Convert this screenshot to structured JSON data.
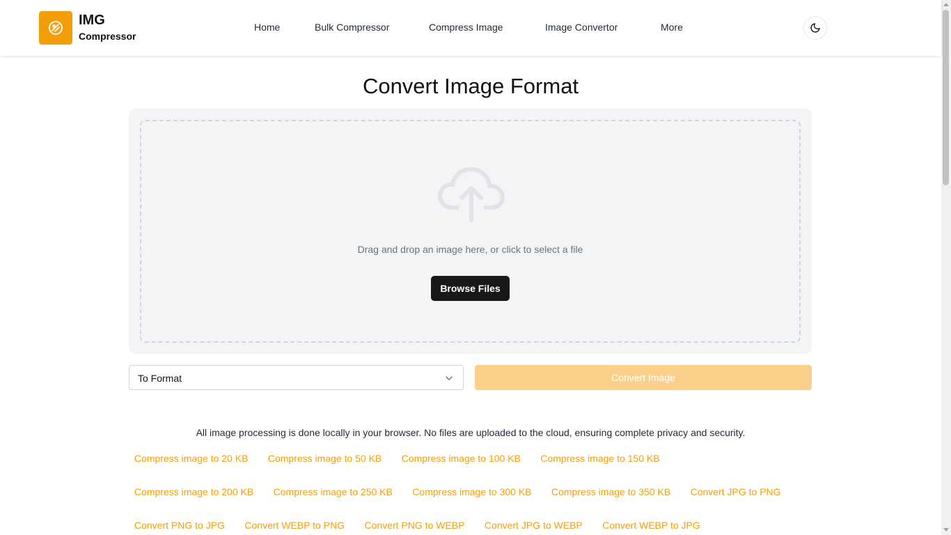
{
  "header": {
    "logo_title": "IMG",
    "logo_subtitle": "Compressor",
    "nav": [
      {
        "label": "Home"
      },
      {
        "label": "Bulk Compressor"
      },
      {
        "label": "Compress Image"
      },
      {
        "label": "Image Convertor"
      },
      {
        "label": "More"
      }
    ],
    "theme_toggle_icon": "moon-icon",
    "brand_color": "#f59e0b"
  },
  "main": {
    "title": "Convert Image Format",
    "dropzone": {
      "icon": "cloud-upload-icon",
      "hint": "Drag and drop an image here, or click to select a file",
      "browse_label": "Browse Files"
    },
    "format_select": {
      "value": "To Format",
      "icon": "chevron-down-icon"
    },
    "convert_label": "Convert Image",
    "privacy_note": "All image processing is done locally in your browser. No files are uploaded to the cloud, ensuring complete privacy and security.",
    "link_rows": [
      [
        "Compress image to 20 KB",
        "Compress image to 50 KB",
        "Compress image to 100 KB",
        "Compress image to 150 KB"
      ],
      [
        "Compress image to 200 KB",
        "Compress image to 250 KB",
        "Compress image to 300 KB",
        "Compress image to 350 KB",
        "Convert JPG to PNG"
      ],
      [
        "Convert PNG to JPG",
        "Convert WEBP to PNG",
        "Convert PNG to WEBP",
        "Convert JPG to WEBP",
        "Convert WEBP to JPG"
      ]
    ]
  }
}
